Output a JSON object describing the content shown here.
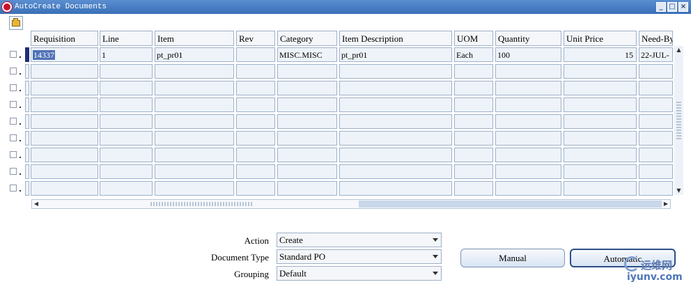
{
  "window": {
    "title": "AutoCreate Documents",
    "controls": [
      "_",
      "□",
      "×"
    ]
  },
  "toolbar": {
    "open_icon": "folder-open-icon"
  },
  "grid": {
    "columns": [
      "Requisition",
      "Line",
      "Item",
      "Rev",
      "Category",
      "Item Description",
      "UOM",
      "Quantity",
      "Unit Price",
      "Need-By"
    ],
    "rows": [
      [
        "14337",
        "1",
        "pt_pr01",
        "",
        "MISC.MISC",
        "pt_pr01",
        "Each",
        "100",
        "15",
        "22-JUL-"
      ]
    ],
    "empty_rows": 8
  },
  "form": {
    "action_label": "Action",
    "action_value": "Create",
    "document_type_label": "Document Type",
    "document_type_value": "Standard PO",
    "grouping_label": "Grouping",
    "grouping_value": "Default"
  },
  "buttons": {
    "manual": "Manual",
    "automatic": "Automatic"
  },
  "watermark": {
    "text_cn": "运维网",
    "url": "iyunv.com"
  }
}
